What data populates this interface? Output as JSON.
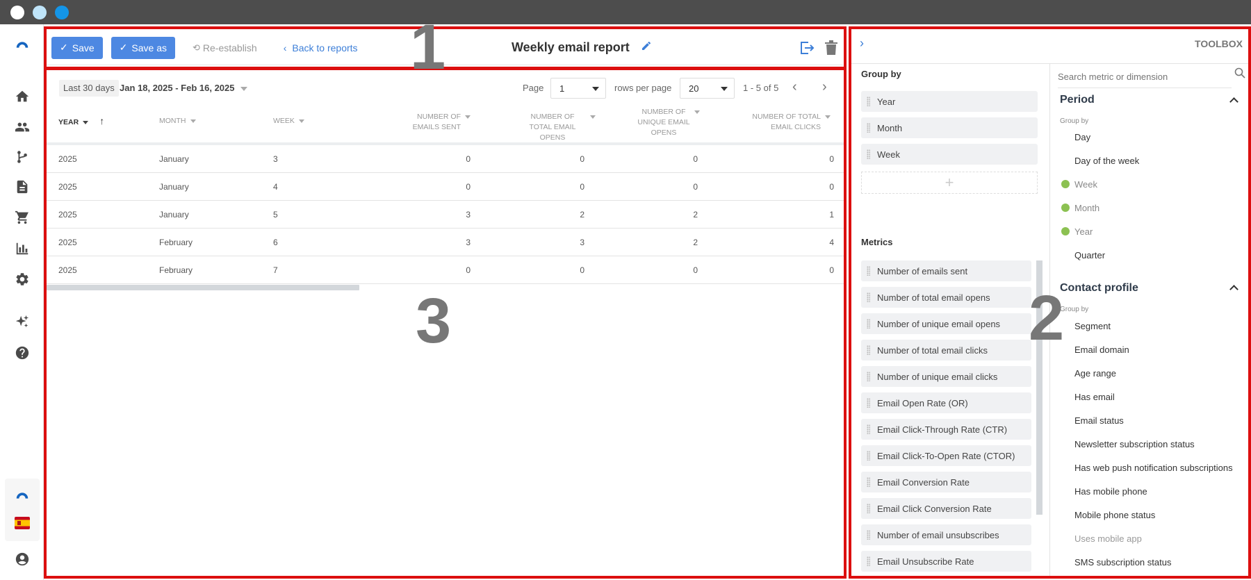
{
  "window": {
    "dots": [
      "#ffffff",
      "#bfe4f9",
      "#1495e8"
    ]
  },
  "sidebar": {
    "items": [
      "home-icon",
      "contacts-icon",
      "automation-icon",
      "content-icon",
      "cart-icon",
      "reports-icon",
      "settings-icon",
      "ai-sparkle-icon",
      "help-icon"
    ],
    "language": "ES"
  },
  "markers": {
    "one": "1",
    "two": "2",
    "three": "3"
  },
  "header": {
    "save": "Save",
    "save_as": "Save as",
    "reestablish": "Re-establish",
    "back": "Back to reports",
    "title": "Weekly email report"
  },
  "filters": {
    "range_label": "Last 30 days",
    "range_dates": "Jan 18, 2025 - Feb 16, 2025",
    "page_label": "Page",
    "page_value": "1",
    "rows_label": "rows per page",
    "rows_value": "20",
    "count": "1 - 5 of 5"
  },
  "table": {
    "columns": [
      "YEAR",
      "MONTH",
      "WEEK",
      "NUMBER OF EMAILS SENT",
      "NUMBER OF TOTAL EMAIL OPENS",
      "NUMBER OF UNIQUE EMAIL OPENS",
      "NUMBER OF TOTAL EMAIL CLICKS"
    ],
    "rows": [
      [
        "2025",
        "January",
        "3",
        "0",
        "0",
        "0",
        "0"
      ],
      [
        "2025",
        "January",
        "4",
        "0",
        "0",
        "0",
        "0"
      ],
      [
        "2025",
        "January",
        "5",
        "3",
        "2",
        "2",
        "1"
      ],
      [
        "2025",
        "February",
        "6",
        "3",
        "3",
        "2",
        "4"
      ],
      [
        "2025",
        "February",
        "7",
        "0",
        "0",
        "0",
        "0"
      ]
    ]
  },
  "toolbox": {
    "title": "TOOLBOX",
    "group_by_label": "Group by",
    "group_by": [
      "Year",
      "Month",
      "Week"
    ],
    "metrics_label": "Metrics",
    "metrics": [
      "Number of emails sent",
      "Number of total email opens",
      "Number of unique email opens",
      "Number of total email clicks",
      "Number of unique email clicks",
      "Email Open Rate (OR)",
      "Email Click-Through Rate (CTR)",
      "Email Click-To-Open Rate (CTOR)",
      "Email Conversion Rate",
      "Email Click Conversion Rate",
      "Number of email unsubscribes",
      "Email Unsubscribe Rate"
    ],
    "search_placeholder": "Search metric or dimension",
    "period": {
      "title": "Period",
      "sub": "Group by",
      "items": [
        {
          "label": "Day",
          "checked": false
        },
        {
          "label": "Day of the week",
          "checked": false
        },
        {
          "label": "Week",
          "checked": true
        },
        {
          "label": "Month",
          "checked": true
        },
        {
          "label": "Year",
          "checked": true
        },
        {
          "label": "Quarter",
          "checked": false
        }
      ]
    },
    "contact": {
      "title": "Contact profile",
      "sub": "Group by",
      "items": [
        "Segment",
        "Email domain",
        "Age range",
        "Has email",
        "Email status",
        "Newsletter subscription status",
        "Has web push notification subscriptions",
        "Has mobile phone",
        "Mobile phone status",
        "Uses mobile app",
        "SMS subscription status"
      ]
    }
  }
}
